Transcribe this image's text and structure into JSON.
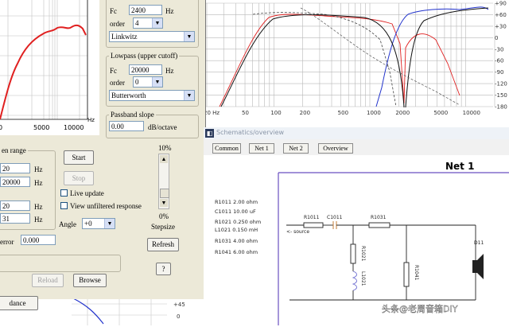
{
  "highpass": {
    "fc_label": "Fc",
    "fc_value": "2400",
    "fc_unit": "Hz",
    "order_label": "order",
    "order_value": "4",
    "filter_type": "Linkwitz"
  },
  "lowpass": {
    "group_title": "Lowpass (upper cutoff)",
    "fc_label": "Fc",
    "fc_value": "20000",
    "fc_unit": "Hz",
    "order_label": "order",
    "order_value": "0",
    "filter_type": "Butterworth"
  },
  "passband": {
    "group_title": "Passband slope",
    "value": "0.00",
    "unit": "dB/octave"
  },
  "small_plot": {
    "x_ticks": [
      "0",
      "5000",
      "10000"
    ],
    "x_unit": "Hz"
  },
  "range": {
    "group_title": "en range",
    "row1": {
      "value": "20",
      "unit": "Hz"
    },
    "row2": {
      "value": "20000",
      "unit": "Hz"
    },
    "row3": {
      "value": "20",
      "unit": "Hz"
    },
    "row4": {
      "value": "31",
      "unit": "Hz"
    }
  },
  "controls": {
    "start_label": "Start",
    "stop_label": "Stop",
    "live_update_label": "Live update",
    "view_unfiltered_label": "View unfiltered response",
    "angle_label": "Angle",
    "angle_value": "+0",
    "stepsize_top": "10%",
    "stepsize_bottom": "0%",
    "stepsize_label": "Stepsize",
    "refresh_label": "Refresh",
    "help_label": "?",
    "error_label": "error",
    "error_value": "0.000",
    "reload_label": "Reload",
    "browse_label": "Browse",
    "impedance_label": "dance"
  },
  "bottom_plot": {
    "y_ticks": [
      "+45",
      "0"
    ]
  },
  "response_plot": {
    "y_ticks": [
      "+90",
      "+60",
      "+30",
      "0",
      "-30",
      "-60",
      "-90",
      "-120",
      "-150",
      "-180"
    ],
    "x_ticks": [
      "20 Hz",
      "50",
      "100",
      "200",
      "500",
      "1000",
      "2000",
      "5000",
      "10000"
    ]
  },
  "schematic": {
    "window_title": "Schematics/overview",
    "tabs": [
      "Common",
      "Net 1",
      "Net 2",
      "Overview"
    ],
    "net_title": "Net 1",
    "components": [
      "R1011   2.00 ohm",
      "C1011  10.00 uF",
      "R1021   0.250 ohm",
      "L1021   0.150 mH",
      "R1031   4.00 ohm",
      "R1041   6.00 ohm"
    ],
    "source_label": "<- source",
    "parts": {
      "r1011": "R1011",
      "c1011": "C1011",
      "r1031": "R1031",
      "r1021": "R1021",
      "l1021": "L1021",
      "r1041": "R1041",
      "d11": "D11"
    }
  },
  "watermark": "头条@老周音箱DIY",
  "colors": {
    "dialog_bg": "#ece9d8",
    "response_red": "#e02020",
    "response_blue": "#2233cc",
    "frame_purple": "#6a4fc0"
  }
}
